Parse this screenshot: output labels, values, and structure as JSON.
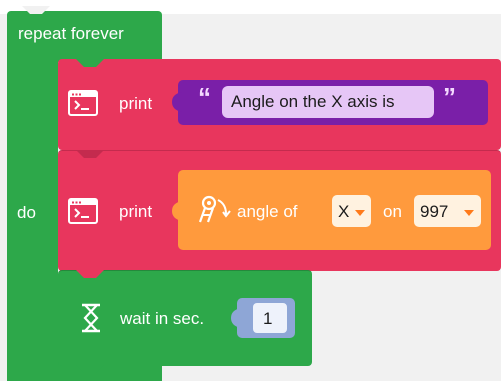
{
  "repeat_block": {
    "title": "repeat forever",
    "do_label": "do",
    "color": "#2da84a"
  },
  "print_block_1": {
    "label": "print",
    "icon": "terminal-icon",
    "text_value": "Angle on the X axis is",
    "open_quote": "“",
    "close_quote": "”",
    "color": "#e8365d",
    "text_block_color": "#7a1fa8"
  },
  "print_block_2": {
    "label": "print",
    "icon": "terminal-icon",
    "angle": {
      "icon": "gyro-sensor-icon",
      "label": "angle of",
      "axis_value": "X",
      "on_label": "on",
      "port_value": "997",
      "color": "#ff9a3d"
    }
  },
  "wait_block": {
    "icon": "hourglass-icon",
    "label": "wait in sec.",
    "seconds": "1",
    "color": "#2da84a"
  }
}
